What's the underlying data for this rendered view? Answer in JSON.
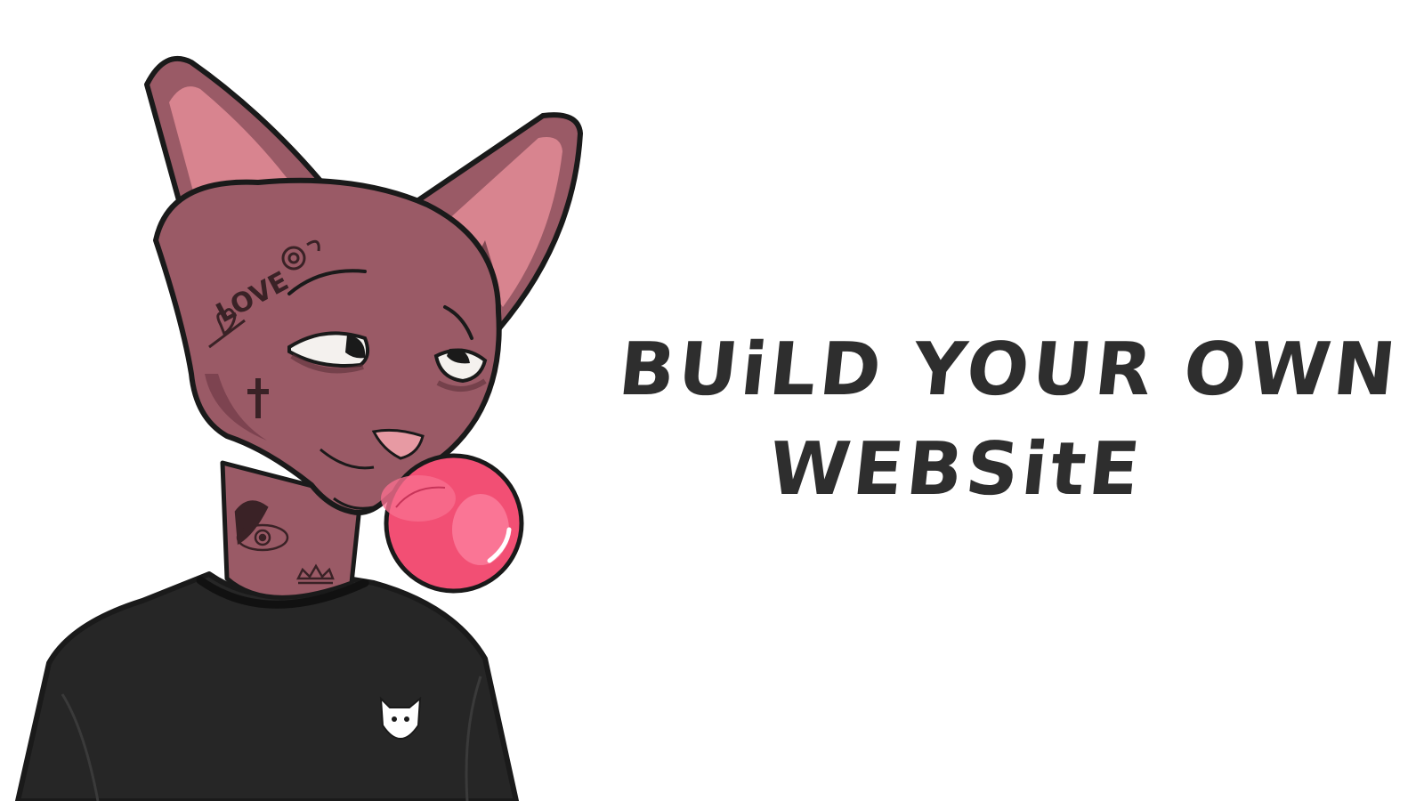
{
  "headline": {
    "line1": "BUiLD YOUR OWN",
    "line2": "WEBSitE"
  },
  "illustration": {
    "subject": "tattooed sphynx cat blowing bubble gum wearing black t-shirt",
    "face_tattoo_text": "LOVE",
    "colors": {
      "skin": "#9a5a66",
      "skin_shade": "#7d4350",
      "ear_inner": "#d8848f",
      "shirt": "#262626",
      "gum": "#f24f74",
      "gum_highlight": "#ff8fab",
      "nose": "#e79aa3",
      "outline": "#1a1a1a",
      "eye_white": "#f4f1ee"
    }
  },
  "colors": {
    "background": "#ffffff",
    "text": "#2e2e2e"
  }
}
